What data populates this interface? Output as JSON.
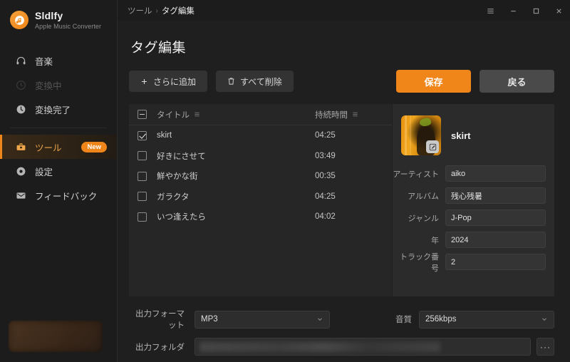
{
  "brand": {
    "name": "Sldlfy",
    "tagline": "Apple Music Converter",
    "logo_icon": "music-note-circle-icon",
    "accent": "#f08519"
  },
  "sidebar": {
    "items": [
      {
        "label": "音楽",
        "icon": "headphones-icon",
        "state": "normal"
      },
      {
        "label": "変換中",
        "icon": "refresh-circle-icon",
        "state": "disabled"
      },
      {
        "label": "変換完了",
        "icon": "clock-icon",
        "state": "normal"
      },
      {
        "label": "ツール",
        "icon": "toolbox-icon",
        "state": "active",
        "badge": "New"
      },
      {
        "label": "設定",
        "icon": "gear-icon",
        "state": "normal"
      },
      {
        "label": "フィードバック",
        "icon": "envelope-icon",
        "state": "normal"
      }
    ],
    "promo_banner": "promo-banner"
  },
  "titlebar": {
    "breadcrumb_parent": "ツール",
    "breadcrumb_separator": "›",
    "breadcrumb_current": "タグ編集",
    "controls": [
      "menu-icon",
      "minimize-icon",
      "maximize-icon",
      "close-icon"
    ]
  },
  "page": {
    "title": "タグ編集"
  },
  "toolbar": {
    "add_more_label": "さらに追加",
    "add_more_icon": "plus-icon",
    "delete_all_label": "すべて削除",
    "delete_all_icon": "trash-icon",
    "save_label": "保存",
    "back_label": "戻る"
  },
  "table": {
    "columns": {
      "title": "タイトル",
      "duration": "持続時間"
    },
    "header_checkbox_state": "indeterminate",
    "rows": [
      {
        "checked": true,
        "title": "skirt",
        "duration": "04:25"
      },
      {
        "checked": false,
        "title": "好きにさせて",
        "duration": "03:49"
      },
      {
        "checked": false,
        "title": "鮮やかな街",
        "duration": "00:35"
      },
      {
        "checked": false,
        "title": "ガラクタ",
        "duration": "04:25"
      },
      {
        "checked": false,
        "title": "いつ逢えたら",
        "duration": "04:02"
      }
    ]
  },
  "detail": {
    "cover_icon": "album-art",
    "cover_edit_icon": "edit-pencil-icon",
    "track_title": "skirt",
    "fields": [
      {
        "label": "アーティスト",
        "value": "aiko"
      },
      {
        "label": "アルバム",
        "value": "残心残暑"
      },
      {
        "label": "ジャンル",
        "value": "J-Pop"
      },
      {
        "label": "年",
        "value": "2024"
      },
      {
        "label": "トラック番号",
        "value": "2"
      }
    ]
  },
  "bottom": {
    "format_label": "出力フォーマット",
    "format_value": "MP3",
    "quality_label": "音質",
    "quality_value": "256kbps",
    "folder_label": "出力フォルダ",
    "folder_value": "",
    "browse_label": "···",
    "chevron_icon": "chevron-down-icon"
  }
}
